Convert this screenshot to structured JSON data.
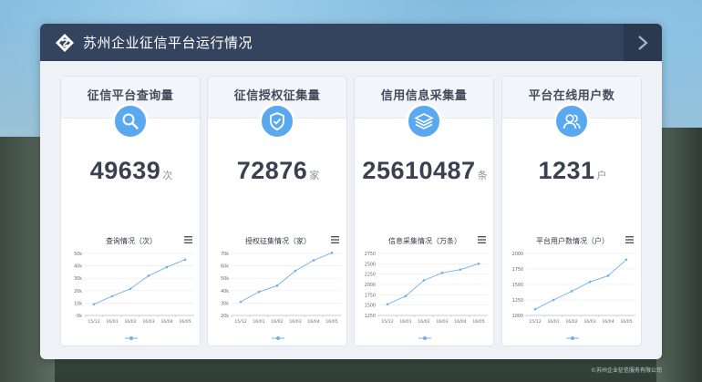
{
  "header": {
    "title": "苏州企业征信平台运行情况"
  },
  "colors": {
    "accent": "#59a8f0",
    "line": "#6fb0ec",
    "header": "#34445f"
  },
  "cards": [
    {
      "title": "征信平台查询量",
      "icon": "search-icon",
      "value": "49639",
      "unit": "次",
      "chart_title": "查询情况（次）"
    },
    {
      "title": "征信授权征集量",
      "icon": "shield-check-icon",
      "value": "72876",
      "unit": "家",
      "chart_title": "授权征集情况（家）"
    },
    {
      "title": "信用信息采集量",
      "icon": "layers-icon",
      "value": "25610487",
      "unit": "条",
      "chart_title": "信息采集情况（万条）"
    },
    {
      "title": "平台在线用户数",
      "icon": "users-icon",
      "value": "1231",
      "unit": "户",
      "chart_title": "平台用户数情况（户）"
    }
  ],
  "chart_data": [
    {
      "type": "line",
      "categories": [
        "15/12",
        "16/01",
        "16/02",
        "16/03",
        "16/04",
        "16/05"
      ],
      "y_ticks": [
        "0k",
        "10k",
        "20k",
        "30k",
        "40k",
        "50k"
      ],
      "ylim": [
        0,
        50
      ],
      "values": [
        9,
        15.5,
        21.5,
        32,
        39,
        45
      ],
      "title": "查询情况（次）"
    },
    {
      "type": "line",
      "categories": [
        "15/12",
        "16/01",
        "16/02",
        "16/03",
        "16/04",
        "16/05"
      ],
      "y_ticks": [
        "20k",
        "30k",
        "40k",
        "50k",
        "60k",
        "70k"
      ],
      "ylim": [
        20,
        70
      ],
      "values": [
        31,
        39,
        44,
        56,
        64.5,
        70.5
      ],
      "title": "授权征集情况（家）"
    },
    {
      "type": "line",
      "categories": [
        "15/12",
        "16/01",
        "16/02",
        "16/03",
        "16/04",
        "16/05"
      ],
      "y_ticks": [
        "1250",
        "1500",
        "1750",
        "2000",
        "2250",
        "2500",
        "2750"
      ],
      "ylim": [
        1250,
        2750
      ],
      "values": [
        1520,
        1720,
        2100,
        2280,
        2360,
        2500
      ],
      "title": "信息采集情况（万条）"
    },
    {
      "type": "line",
      "categories": [
        "15/12",
        "16/01",
        "16/02",
        "16/03",
        "16/04",
        "16/05"
      ],
      "y_ticks": [
        "1000",
        "1250",
        "1500",
        "1750",
        "2000"
      ],
      "ylim": [
        1000,
        2000
      ],
      "values": [
        1100,
        1250,
        1390,
        1540,
        1640,
        1900
      ],
      "title": "平台用户数情况（户）"
    }
  ],
  "footer": {
    "text": "©苏州企业征信服务有限公司"
  }
}
